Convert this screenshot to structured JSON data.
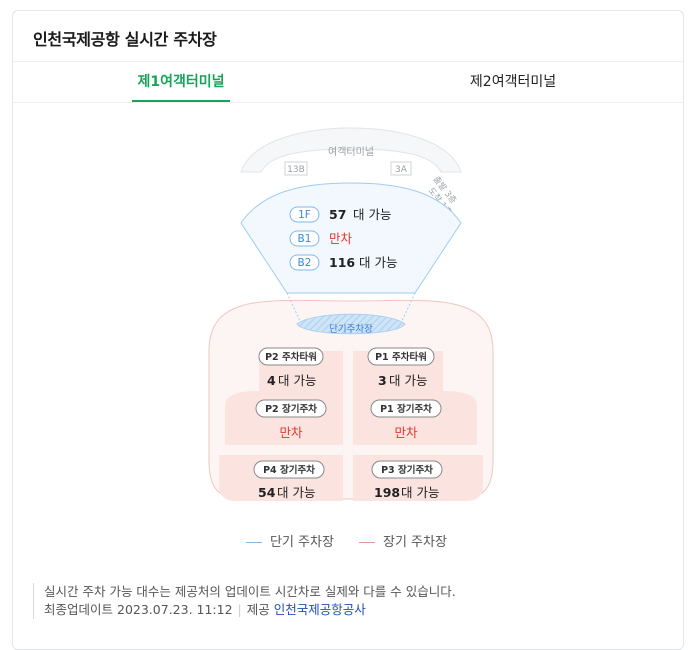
{
  "title": "인천국제공항 실시간 주차장",
  "tabs": [
    {
      "label": "제1여객터미널",
      "active": true
    },
    {
      "label": "제2여객터미널",
      "active": false
    }
  ],
  "terminal": {
    "label": "여객터미널",
    "gate_left": "13B",
    "gate_right": "3A",
    "exit_note_1": "출발 3층",
    "exit_note_2": "도착 1층"
  },
  "short_term": {
    "label": "단기주차장",
    "floors": [
      {
        "name": "1F",
        "count": "57",
        "status": "대 가능",
        "full": false
      },
      {
        "name": "B1",
        "count": "",
        "status": "만차",
        "full": true
      },
      {
        "name": "B2",
        "count": "116",
        "status": "대 가능",
        "full": false
      }
    ]
  },
  "long_term": [
    {
      "name": "P2 주차타워",
      "count": "4",
      "status": "대 가능",
      "full": false
    },
    {
      "name": "P1 주차타워",
      "count": "3",
      "status": "대 가능",
      "full": false
    },
    {
      "name": "P2 장기주차",
      "count": "",
      "status": "만차",
      "full": true
    },
    {
      "name": "P1 장기주차",
      "count": "",
      "status": "만차",
      "full": true
    },
    {
      "name": "P4 장기주차",
      "count": "54",
      "status": "대 가능",
      "full": false
    },
    {
      "name": "P3 장기주차",
      "count": "198",
      "status": "대 가능",
      "full": false
    }
  ],
  "legend": {
    "short": "단기 주차장",
    "long": "장기 주차장",
    "short_color": "#7fb8e6",
    "long_color": "#e8998d"
  },
  "notes": {
    "disclaimer": "실시간 주차 가능 대수는 제공처의 업데이트 시간차로 실제와 다를 수 있습니다.",
    "updated_label": "최종업데이트",
    "updated_time": "2023.07.23. 11:12",
    "provider_label": "제공",
    "provider": "인천국제공항공사"
  },
  "colors": {
    "accent": "#18a35a",
    "full": "#e0392b",
    "short_bg": "#eef6fd",
    "long_bg": "#fdeeed"
  }
}
